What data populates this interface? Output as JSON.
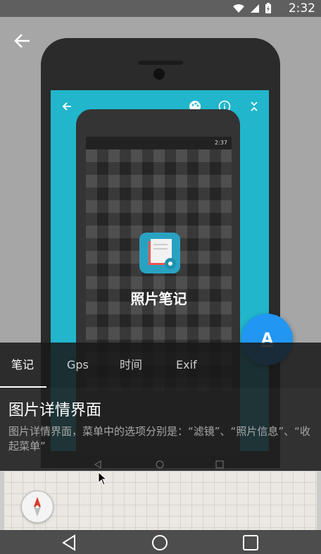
{
  "status_bar": {
    "time": "2:32",
    "icons": [
      "wifi-icon",
      "signal-icon",
      "battery-charging-icon"
    ]
  },
  "screenshot_in_photo": {
    "inner_status_time": "2:37",
    "app_name": "照片笔记",
    "toolbar_icons": [
      "back-arrow-icon",
      "palette-icon",
      "info-icon",
      "collapse-icon"
    ]
  },
  "fab": {
    "label": "A",
    "color": "#2196f3"
  },
  "tabs": [
    {
      "label": "笔记",
      "active": true
    },
    {
      "label": "Gps",
      "active": false
    },
    {
      "label": "时间",
      "active": false
    },
    {
      "label": "Exif",
      "active": false
    }
  ],
  "info": {
    "title": "图片详情界面",
    "description": "图片详情界面，菜单中的选项分别是：“滤镜”、“照片信息”、“收起菜单”"
  },
  "colors": {
    "accent_cyan": "#21b6cc",
    "fab_blue": "#2196f3"
  },
  "map": {
    "compass_icon": "compass-icon"
  },
  "nav": {
    "buttons": [
      "back-icon",
      "home-icon",
      "recents-icon"
    ]
  }
}
